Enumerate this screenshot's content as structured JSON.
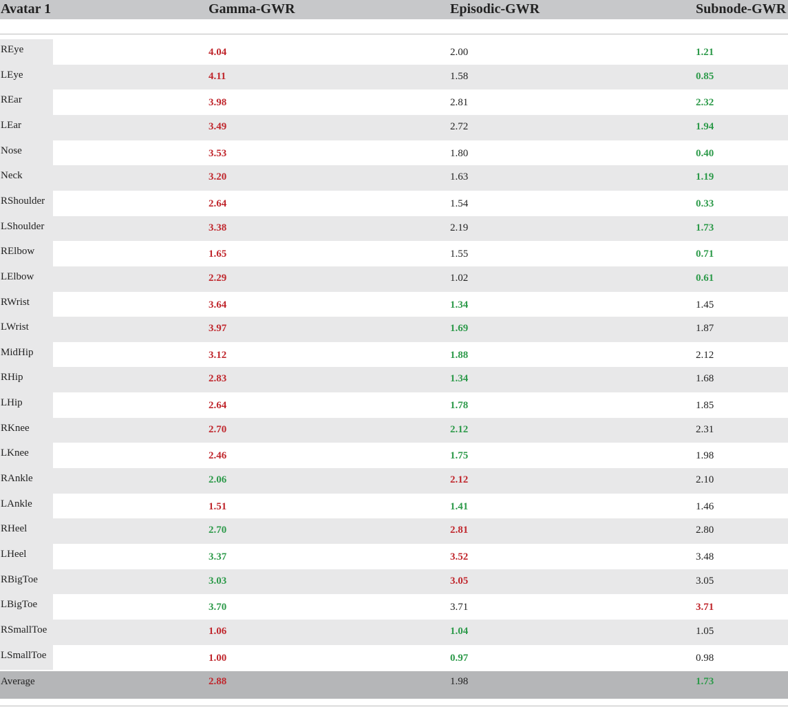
{
  "table": {
    "headers": [
      "Avatar 1",
      "Gamma-GWR",
      "Episodic-GWR",
      "Subnode-GWR"
    ],
    "rows": [
      {
        "label": "REye",
        "values": [
          "4.04",
          "2.00",
          "1.21"
        ],
        "colors": [
          "red",
          "plain",
          "green"
        ]
      },
      {
        "label": "LEye",
        "values": [
          "4.11",
          "1.58",
          "0.85"
        ],
        "colors": [
          "red",
          "plain",
          "green"
        ]
      },
      {
        "label": "REar",
        "values": [
          "3.98",
          "2.81",
          "2.32"
        ],
        "colors": [
          "red",
          "plain",
          "green"
        ]
      },
      {
        "label": "LEar",
        "values": [
          "3.49",
          "2.72",
          "1.94"
        ],
        "colors": [
          "red",
          "plain",
          "green"
        ]
      },
      {
        "label": "Nose",
        "values": [
          "3.53",
          "1.80",
          "0.40"
        ],
        "colors": [
          "red",
          "plain",
          "green"
        ]
      },
      {
        "label": "Neck",
        "values": [
          "3.20",
          "1.63",
          "1.19"
        ],
        "colors": [
          "red",
          "plain",
          "green"
        ]
      },
      {
        "label": "RShoulder",
        "values": [
          "2.64",
          "1.54",
          "0.33"
        ],
        "colors": [
          "red",
          "plain",
          "green"
        ]
      },
      {
        "label": "LShoulder",
        "values": [
          "3.38",
          "2.19",
          "1.73"
        ],
        "colors": [
          "red",
          "plain",
          "green"
        ]
      },
      {
        "label": "RElbow",
        "values": [
          "1.65",
          "1.55",
          "0.71"
        ],
        "colors": [
          "red",
          "plain",
          "green"
        ]
      },
      {
        "label": "LElbow",
        "values": [
          "2.29",
          "1.02",
          "0.61"
        ],
        "colors": [
          "red",
          "plain",
          "green"
        ]
      },
      {
        "label": "RWrist",
        "values": [
          "3.64",
          "1.34",
          "1.45"
        ],
        "colors": [
          "red",
          "green",
          "plain"
        ]
      },
      {
        "label": "LWrist",
        "values": [
          "3.97",
          "1.69",
          "1.87"
        ],
        "colors": [
          "red",
          "green",
          "plain"
        ]
      },
      {
        "label": "MidHip",
        "values": [
          "3.12",
          "1.88",
          "2.12"
        ],
        "colors": [
          "red",
          "green",
          "plain"
        ]
      },
      {
        "label": "RHip",
        "values": [
          "2.83",
          "1.34",
          "1.68"
        ],
        "colors": [
          "red",
          "green",
          "plain"
        ]
      },
      {
        "label": "LHip",
        "values": [
          "2.64",
          "1.78",
          "1.85"
        ],
        "colors": [
          "red",
          "green",
          "plain"
        ]
      },
      {
        "label": "RKnee",
        "values": [
          "2.70",
          "2.12",
          "2.31"
        ],
        "colors": [
          "red",
          "green",
          "plain"
        ]
      },
      {
        "label": "LKnee",
        "values": [
          "2.46",
          "1.75",
          "1.98"
        ],
        "colors": [
          "red",
          "green",
          "plain"
        ]
      },
      {
        "label": "RAnkle",
        "values": [
          "2.06",
          "2.12",
          "2.10"
        ],
        "colors": [
          "green",
          "red",
          "plain"
        ]
      },
      {
        "label": "LAnkle",
        "values": [
          "1.51",
          "1.41",
          "1.46"
        ],
        "colors": [
          "red",
          "green",
          "plain"
        ]
      },
      {
        "label": "RHeel",
        "values": [
          "2.70",
          "2.81",
          "2.80"
        ],
        "colors": [
          "green",
          "red",
          "plain"
        ]
      },
      {
        "label": "LHeel",
        "values": [
          "3.37",
          "3.52",
          "3.48"
        ],
        "colors": [
          "green",
          "red",
          "plain"
        ]
      },
      {
        "label": "RBigToe",
        "values": [
          "3.03",
          "3.05",
          "3.05"
        ],
        "colors": [
          "green",
          "red",
          "plain"
        ]
      },
      {
        "label": "LBigToe",
        "values": [
          "3.70",
          "3.71",
          "3.71"
        ],
        "colors": [
          "green",
          "plain",
          "red"
        ]
      },
      {
        "label": "RSmallToe",
        "values": [
          "1.06",
          "1.04",
          "1.05"
        ],
        "colors": [
          "red",
          "green",
          "plain"
        ]
      },
      {
        "label": "LSmallToe",
        "values": [
          "1.00",
          "0.97",
          "0.98"
        ],
        "colors": [
          "red",
          "green",
          "plain"
        ]
      }
    ],
    "average": {
      "label": "Average",
      "values": [
        "2.88",
        "1.98",
        "1.73"
      ],
      "colors": [
        "red",
        "plain",
        "green"
      ]
    }
  },
  "colors": {
    "red": "#c0272d",
    "green": "#2d9a4a",
    "header_bg": "#c7c8ca",
    "stripe": "#e8e8e9",
    "average_bg": "#b5b6b8"
  }
}
